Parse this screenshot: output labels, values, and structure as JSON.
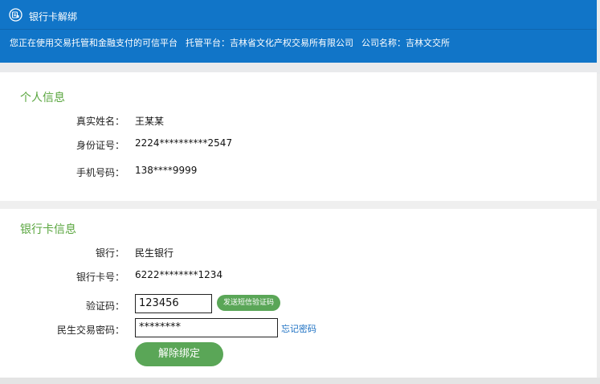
{
  "header": {
    "title": "银行卡解绑",
    "platform_desc": "您正在使用交易托管和金融支付的可信平台",
    "custody_platform": "托管平台：吉林省文化产权交易所有限公司",
    "company_name": "公司名称：吉林文交所"
  },
  "personal": {
    "section_title": "个人信息",
    "name_label": "真实姓名：",
    "name_value": "王某某",
    "id_label": "身份证号：",
    "id_value": "2224**********2547",
    "phone_label": "手机号码：",
    "phone_value": "138****9999"
  },
  "bank": {
    "section_title": "银行卡信息",
    "bank_label": "银行：",
    "bank_value": "民生银行",
    "card_label": "银行卡号：",
    "card_value": "6222********1234",
    "code_label": "验证码：",
    "code_value": "123456",
    "sms_button": "发送短信验证码",
    "password_label": "民生交易密码：",
    "password_value": "********",
    "forget_link": "忘记密码",
    "unbind_button": "解除绑定"
  },
  "colors": {
    "header_blue": "#1175c8",
    "accent_green": "#5aa657",
    "link_blue": "#1a6fc2"
  }
}
